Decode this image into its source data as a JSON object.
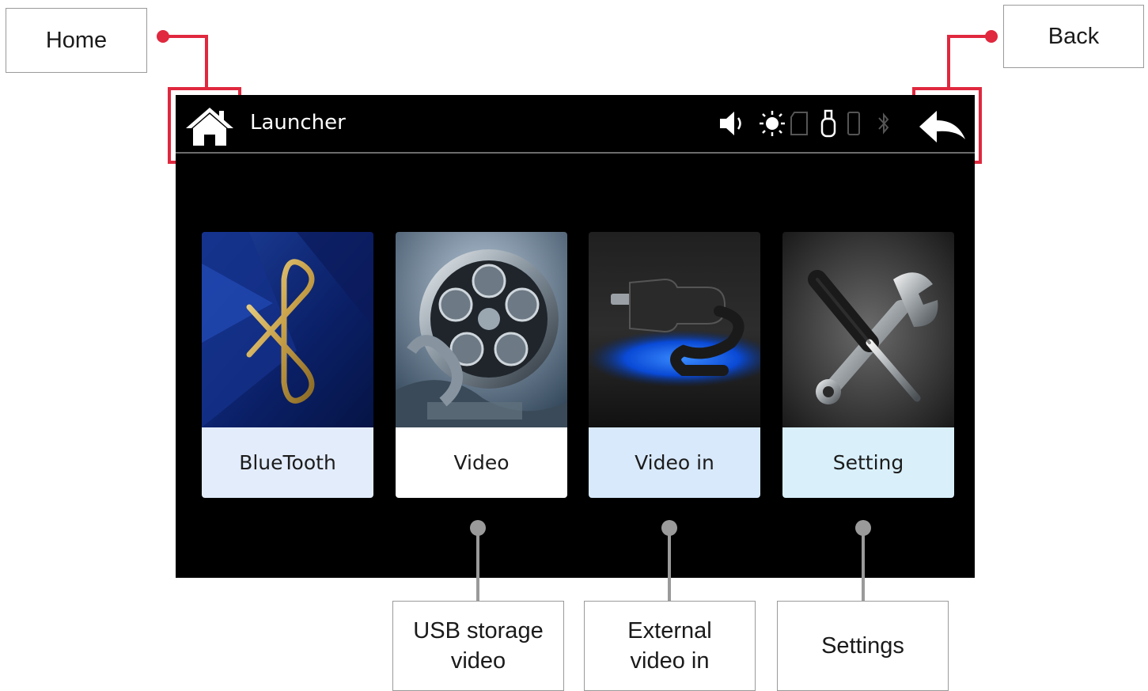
{
  "screen": {
    "title": "Launcher",
    "tiles": [
      {
        "label": "BlueTooth",
        "icon": "bluetooth-icon",
        "label_bg": "#e3ecfb"
      },
      {
        "label": "Video",
        "icon": "film-reel-icon",
        "label_bg": "#ffffff"
      },
      {
        "label": "Video in",
        "icon": "plug-icon",
        "label_bg": "#d8e9fb"
      },
      {
        "label": "Setting",
        "icon": "tools-icon",
        "label_bg": "#d9f0fb"
      }
    ],
    "status_icons": [
      "volume-icon",
      "brightness-icon",
      "sd-card-icon",
      "usb-icon",
      "phone-icon",
      "bluetooth-status-icon"
    ]
  },
  "callouts": {
    "home": "Home",
    "back": "Back",
    "usb_video": "USB storage\nvideo",
    "external_video": "External\nvideo in",
    "settings": "Settings"
  },
  "colors": {
    "highlight": "#e0283e",
    "connector": "#9a9a9a",
    "screen_bg": "#000000"
  }
}
